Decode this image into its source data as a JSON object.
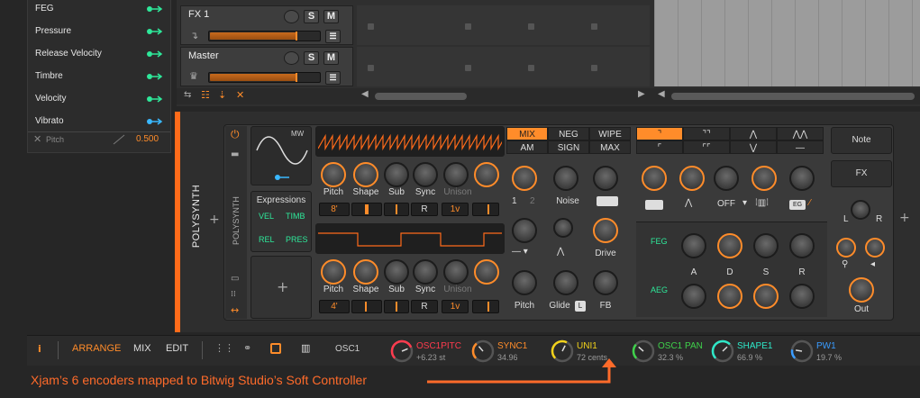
{
  "modulators": {
    "items": [
      {
        "label": "FEG",
        "color": "#2ee89a"
      },
      {
        "label": "Pressure",
        "color": "#2ee89a"
      },
      {
        "label": "Release Velocity",
        "color": "#2ee89a"
      },
      {
        "label": "Timbre",
        "color": "#2ee89a"
      },
      {
        "label": "Velocity",
        "color": "#2ee89a"
      },
      {
        "label": "Vibrato",
        "color": "#3ab8ff"
      }
    ],
    "pitch_label": "Pitch",
    "pitch_value": "0.500"
  },
  "tracks": [
    {
      "name": "FX 1",
      "mute": "M",
      "solo": "S"
    },
    {
      "name": "Master",
      "mute": "M",
      "solo": "S"
    }
  ],
  "device": {
    "title": "POLYSYNTH",
    "lfo_label": "MW",
    "osc1": {
      "labels": [
        "Pitch",
        "Shape",
        "Sub",
        "Sync",
        "Unison"
      ],
      "values": [
        "8'",
        "",
        "",
        "R",
        "1v"
      ]
    },
    "osc2": {
      "labels": [
        "Pitch",
        "Shape",
        "Sub",
        "Sync",
        "Unison"
      ],
      "values": [
        "4'",
        "",
        "",
        "R",
        "1v"
      ]
    },
    "expressions": {
      "title": "Expressions",
      "items": [
        "VEL",
        "TIMB",
        "REL",
        "PRES"
      ]
    },
    "side_label": "POLYSYNTH",
    "mix_tabs": [
      [
        "MIX",
        "NEG",
        "WIPE"
      ],
      [
        "AM",
        "SIGN",
        "MAX"
      ]
    ],
    "mixer": {
      "n1": "1",
      "n2": "2",
      "noise": "Noise",
      "drive": "Drive",
      "pitch": "Pitch",
      "glide": "Glide",
      "glide_badge": "L",
      "fb": "FB"
    },
    "filter": {
      "off_label": "OFF",
      "eg_label": "EG"
    },
    "env": {
      "feg": "FEG",
      "aeg": "AEG",
      "labels": [
        "A",
        "D",
        "S",
        "R"
      ]
    },
    "note_btn": "Note",
    "fx_btn": "FX",
    "out_labels": {
      "l": "L",
      "r": "R",
      "out": "Out"
    }
  },
  "bottombar": {
    "tabs": [
      "ARRANGE",
      "MIX",
      "EDIT"
    ],
    "active_tab": "ARRANGE",
    "page_name": "OSC1",
    "encoders": [
      {
        "name": "OSC1PITC",
        "value": "+6.23 st",
        "color": "#ff3b4e",
        "level": 0.75
      },
      {
        "name": "SYNC1",
        "value": "34.96",
        "color": "#ff8c2a",
        "level": 0.35
      },
      {
        "name": "UNI1",
        "value": "72 cents",
        "color": "#f2d21b",
        "level": 0.6
      },
      {
        "name": "OSC1 PAN",
        "value": "32.3 %",
        "color": "#3fd14b",
        "level": 0.32
      },
      {
        "name": "SHAPE1",
        "value": "66.9 %",
        "color": "#2ee8c8",
        "level": 0.67
      },
      {
        "name": "PW1",
        "value": "19.7 %",
        "color": "#3a9cff",
        "level": 0.2
      }
    ]
  },
  "caption": "Xjam’s 6 encoders mapped to Bitwig Studio’s Soft Controller"
}
